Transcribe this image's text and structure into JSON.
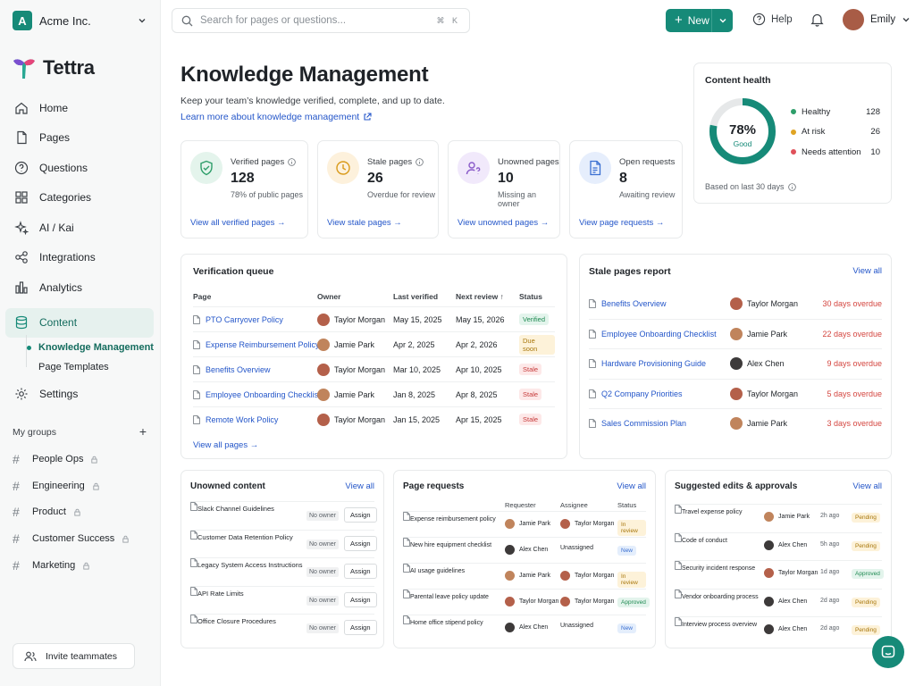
{
  "org": {
    "initial": "A",
    "name": "Acme Inc."
  },
  "brand": {
    "name": "Tettra",
    "accent": "#168a78"
  },
  "search": {
    "placeholder": "Search for pages or questions...",
    "shortcut": "⌘ K"
  },
  "topbar": {
    "new_label": "New",
    "help_label": "Help",
    "user_name": "Emily"
  },
  "nav": {
    "items": [
      {
        "label": "Home",
        "icon": "home-icon"
      },
      {
        "label": "Pages",
        "icon": "pages-icon"
      },
      {
        "label": "Questions",
        "icon": "question-icon"
      },
      {
        "label": "Categories",
        "icon": "grid-icon"
      },
      {
        "label": "AI / Kai",
        "icon": "sparkle-icon"
      },
      {
        "label": "Integrations",
        "icon": "integrations-icon"
      },
      {
        "label": "Analytics",
        "icon": "analytics-icon"
      }
    ],
    "content_label": "Content",
    "sub_items": [
      "Knowledge Management",
      "Page Templates"
    ],
    "settings_label": "Settings"
  },
  "groups": {
    "header": "My groups",
    "items": [
      "People Ops",
      "Engineering",
      "Product",
      "Customer Success",
      "Marketing"
    ]
  },
  "invite_label": "Invite teammates",
  "page": {
    "title": "Knowledge Management",
    "subtitle": "Keep your team’s knowledge verified, complete, and up to date.",
    "learn_more": "Learn more about knowledge management"
  },
  "stats": [
    {
      "label": "Verified pages",
      "value": "128",
      "desc": "78% of public pages",
      "link": "View all verified pages →",
      "color": "#2e9e6a",
      "bg": "#e4f4ec"
    },
    {
      "label": "Stale pages",
      "value": "26",
      "desc": "Overdue for review",
      "link": "View stale pages →",
      "color": "#d99a1a",
      "bg": "#fdf1dc"
    },
    {
      "label": "Unowned pages",
      "value": "10",
      "desc": "Missing an owner",
      "link": "View unowned pages →",
      "color": "#8a5bc9",
      "bg": "#f1e9fb"
    },
    {
      "label": "Open requests",
      "value": "8",
      "desc": "Awaiting review",
      "link": "View page requests →",
      "color": "#3a6fd1",
      "bg": "#e6eefc"
    }
  ],
  "health": {
    "title": "Content health",
    "percent": 78,
    "percent_label": "78%",
    "status": "Good",
    "legend": [
      {
        "label": "Healthy",
        "value": "128",
        "color": "#2e9e6a"
      },
      {
        "label": "At risk",
        "value": "26",
        "color": "#e0a423"
      },
      {
        "label": "Needs attention",
        "value": "10",
        "color": "#e0515a"
      }
    ],
    "footer": "Based on last 30 days"
  },
  "queue": {
    "title": "Verification queue",
    "headers": {
      "page": "Page",
      "owner": "Owner",
      "last": "Last verified",
      "next": "Next review ↑",
      "status": "Status"
    },
    "rows": [
      {
        "page": "PTO Carryover Policy",
        "owner": "Taylor Morgan",
        "last": "May 15, 2025",
        "next": "May 15, 2026",
        "status": "Verified"
      },
      {
        "page": "Expense Reimbursement Policy",
        "owner": "Jamie Park",
        "last": "Apr 2, 2025",
        "next": "Apr 2, 2026",
        "status": "Due soon"
      },
      {
        "page": "Benefits Overview",
        "owner": "Taylor Morgan",
        "last": "Mar 10, 2025",
        "next": "Apr 10, 2025",
        "status": "Stale"
      },
      {
        "page": "Employee Onboarding Checklist",
        "owner": "Jamie Park",
        "last": "Jan 8, 2025",
        "next": "Apr 8, 2025",
        "status": "Stale"
      },
      {
        "page": "Remote Work Policy",
        "owner": "Taylor Morgan",
        "last": "Jan 15, 2025",
        "next": "Apr 15, 2025",
        "status": "Stale"
      }
    ],
    "view_all": "View all pages →"
  },
  "stale": {
    "title": "Stale pages report",
    "view_all": "View all",
    "rows": [
      {
        "page": "Benefits Overview",
        "owner": "Taylor Morgan",
        "overdue": "30 days overdue"
      },
      {
        "page": "Employee Onboarding Checklist",
        "owner": "Jamie Park",
        "overdue": "22 days overdue"
      },
      {
        "page": "Hardware Provisioning Guide",
        "owner": "Alex Chen",
        "overdue": "9 days overdue"
      },
      {
        "page": "Q2 Company Priorities",
        "owner": "Taylor Morgan",
        "overdue": "5 days overdue"
      },
      {
        "page": "Sales Commission Plan",
        "owner": "Jamie Park",
        "overdue": "3 days overdue"
      }
    ]
  },
  "unowned": {
    "title": "Unowned content",
    "view_all": "View all",
    "no_owner": "No owner",
    "assign": "Assign",
    "rows": [
      "Slack Channel Guidelines",
      "Customer Data Retention Policy",
      "Legacy System Access Instructions",
      "API Rate Limits",
      "Office Closure Procedures"
    ]
  },
  "requests": {
    "title": "Page requests",
    "view_all": "View all",
    "headers": {
      "requester": "Requester",
      "assignee": "Assignee",
      "status": "Status"
    },
    "rows": [
      {
        "page": "Expense reimbursement policy",
        "requester": "Jamie Park",
        "assignee": "Taylor Morgan",
        "status": "In review"
      },
      {
        "page": "New hire equipment checklist",
        "requester": "Alex Chen",
        "assignee": "Unassigned",
        "status": "New"
      },
      {
        "page": "AI usage guidelines",
        "requester": "Jamie Park",
        "assignee": "Taylor Morgan",
        "status": "In review"
      },
      {
        "page": "Parental leave policy update",
        "requester": "Taylor Morgan",
        "assignee": "Taylor Morgan",
        "status": "Approved"
      },
      {
        "page": "Home office stipend policy",
        "requester": "Alex Chen",
        "assignee": "Unassigned",
        "status": "New"
      }
    ]
  },
  "suggested": {
    "title": "Suggested edits & approvals",
    "view_all": "View all",
    "rows": [
      {
        "page": "Travel expense policy",
        "user": "Jamie Park",
        "time": "2h ago",
        "status": "Pending"
      },
      {
        "page": "Code of conduct",
        "user": "Alex Chen",
        "time": "5h ago",
        "status": "Pending"
      },
      {
        "page": "Security incident response",
        "user": "Taylor Morgan",
        "time": "1d ago",
        "status": "Approved"
      },
      {
        "page": "Vendor onboarding process",
        "user": "Alex Chen",
        "time": "2d ago",
        "status": "Pending"
      },
      {
        "page": "Interview process overview",
        "user": "Alex Chen",
        "time": "2d ago",
        "status": "Pending"
      }
    ]
  },
  "avatar_colors": {
    "Taylor Morgan": "#b4604a",
    "Jamie Park": "#c0845c",
    "Alex Chen": "#3d3a3a",
    "Emily": "#a85c46"
  }
}
